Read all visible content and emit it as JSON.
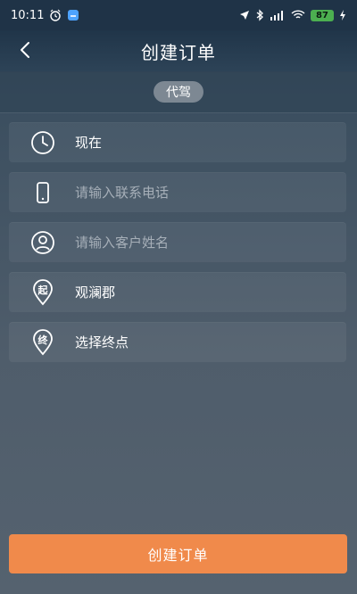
{
  "status_bar": {
    "time": "10:11",
    "battery": "87",
    "icons": [
      "alarm-icon",
      "app-icon",
      "location-icon",
      "bluetooth-icon",
      "signal-icon",
      "wifi-icon",
      "battery-icon",
      "charging-icon"
    ]
  },
  "header": {
    "title": "创建订单",
    "back_icon": "chevron-left-icon"
  },
  "tabs": {
    "selected": "代驾"
  },
  "form": {
    "time": {
      "icon": "clock-icon",
      "value": "现在"
    },
    "phone": {
      "icon": "phone-icon",
      "placeholder": "请输入联系电话"
    },
    "customer": {
      "icon": "user-icon",
      "placeholder": "请输入客户姓名"
    },
    "start": {
      "icon": "start-pin-icon",
      "pin_text": "起",
      "value": "观澜郡"
    },
    "end": {
      "icon": "end-pin-icon",
      "pin_text": "终",
      "value": "选择终点"
    }
  },
  "actions": {
    "create_label": "创建订单"
  },
  "colors": {
    "accent": "#f08a4b",
    "background": "#4f5d6b",
    "header": "#203549"
  }
}
